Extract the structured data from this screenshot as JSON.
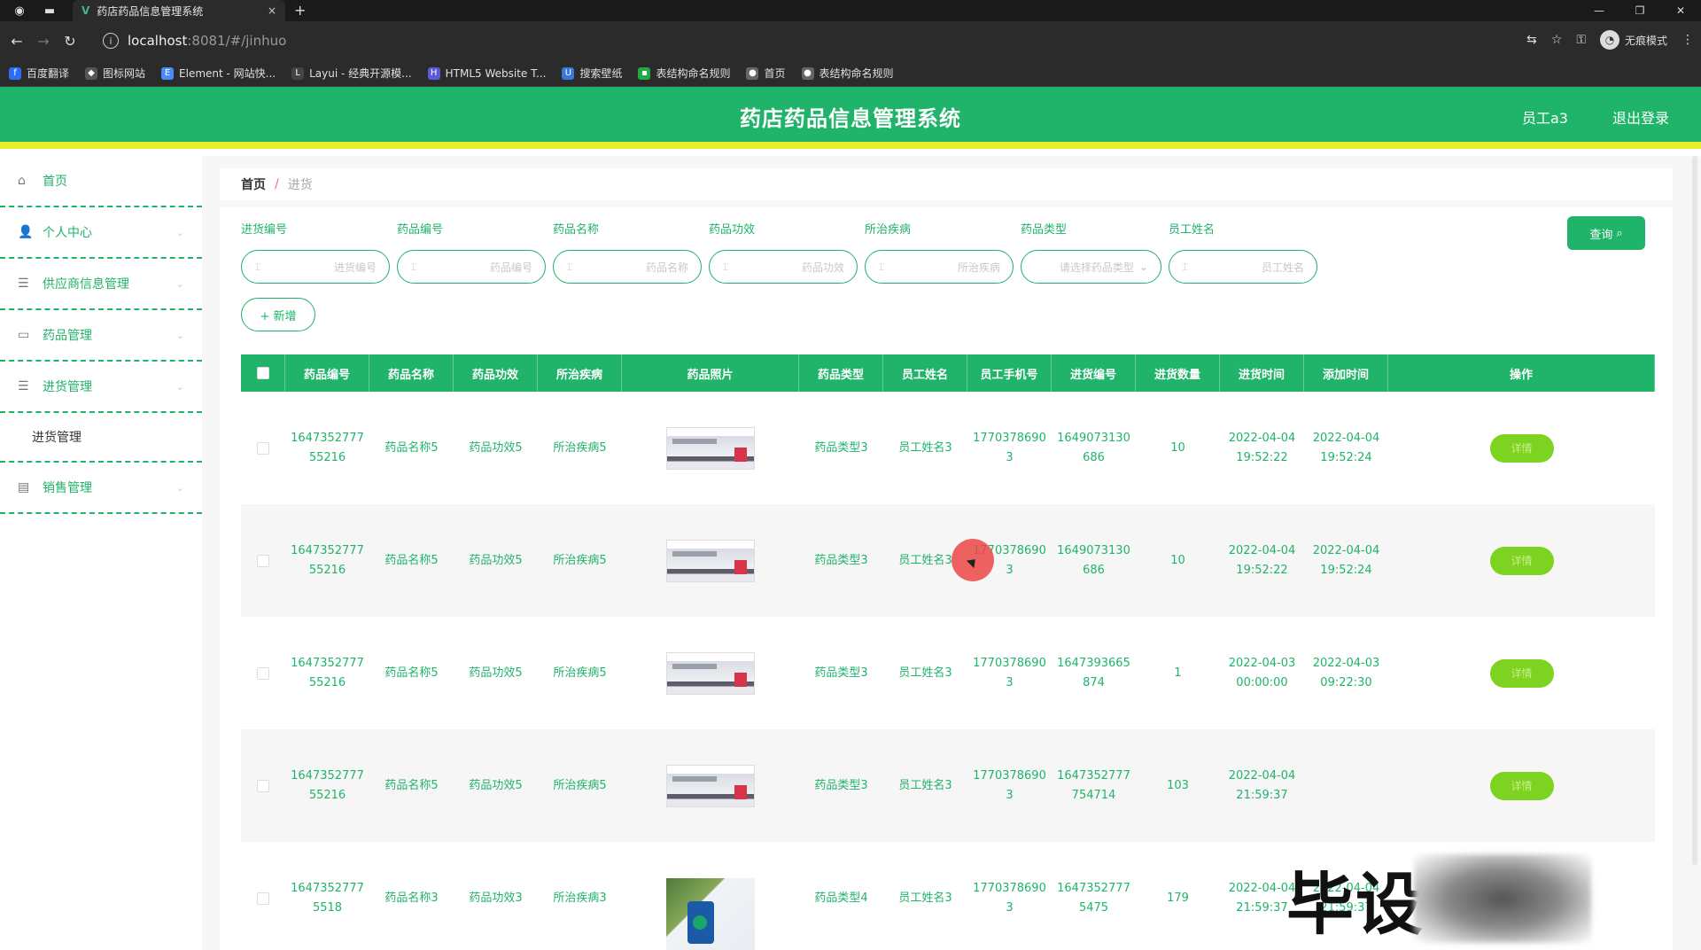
{
  "browser": {
    "tab_title": "药店药品信息管理系统",
    "tab_close": "×",
    "new_tab": "+",
    "url_host": "localhost",
    "url_path": ":8081/#/jinhuo",
    "profile_label": "无痕模式",
    "bookmarks": [
      {
        "label": "百度翻译",
        "color": "#2a6ef5",
        "glyph": "f"
      },
      {
        "label": "图标网站",
        "color": "#555555",
        "glyph": "◆"
      },
      {
        "label": "Element - 网站快...",
        "color": "#4a8cf7",
        "glyph": "E"
      },
      {
        "label": "Layui - 经典开源模...",
        "color": "#444444",
        "glyph": "L"
      },
      {
        "label": "HTML5 Website T...",
        "color": "#5a5ad8",
        "glyph": "H"
      },
      {
        "label": "搜索壁纸",
        "color": "#3a78d8",
        "glyph": "U"
      },
      {
        "label": "表结构命名规则",
        "color": "#22aa44",
        "glyph": "▪"
      },
      {
        "label": "首页",
        "color": "#666666",
        "glyph": "●"
      },
      {
        "label": "表结构命名规则",
        "color": "#666666",
        "glyph": "●"
      }
    ]
  },
  "header": {
    "title": "药店药品信息管理系统",
    "user": "员工a3",
    "logout": "退出登录"
  },
  "sidebar": {
    "items": [
      {
        "label": "首页",
        "icon": "home-icon",
        "glyph": "⌂"
      },
      {
        "label": "个人中心",
        "icon": "user-icon",
        "glyph": "👤"
      },
      {
        "label": "供应商信息管理",
        "icon": "menu-icon",
        "glyph": "☰"
      },
      {
        "label": "药品管理",
        "icon": "document-icon",
        "glyph": "▭"
      },
      {
        "label": "进货管理",
        "icon": "menu-icon",
        "glyph": "☰"
      }
    ],
    "submenu_label": "进货管理",
    "last_item": {
      "label": "销售管理",
      "icon": "chart-icon",
      "glyph": "▤"
    }
  },
  "breadcrumb": {
    "home": "首页",
    "sep": "/",
    "current": "进货"
  },
  "filters": [
    {
      "label": "进货编号",
      "placeholder": "进货编号"
    },
    {
      "label": "药品编号",
      "placeholder": "药品编号"
    },
    {
      "label": "药品名称",
      "placeholder": "药品名称"
    },
    {
      "label": "药品功效",
      "placeholder": "药品功效"
    },
    {
      "label": "所治疾病",
      "placeholder": "所治疾病"
    },
    {
      "label": "药品类型",
      "placeholder": "请选择药品类型"
    },
    {
      "label": "员工姓名",
      "placeholder": "员工姓名"
    }
  ],
  "actions": {
    "search": "查询",
    "add": "+ 新增",
    "detail": "详情"
  },
  "table": {
    "headers": [
      "药品编号",
      "药品名称",
      "药品功效",
      "所治疾病",
      "药品照片",
      "药品类型",
      "员工姓名",
      "员工手机号",
      "进货编号",
      "进货数量",
      "进货时间",
      "添加时间",
      "操作"
    ],
    "rows": [
      {
        "drug_no": "164735277755216",
        "name": "药品名称5",
        "effect": "药品功效5",
        "disease": "所治疾病5",
        "photo": "box",
        "type": "药品类型3",
        "staff": "员工姓名3",
        "phone": "17703786903",
        "purchase_no": "1649073130686",
        "qty": "10",
        "purchase_time": "2022-04-04 19:52:22",
        "add_time": "2022-04-04 19:52:24"
      },
      {
        "drug_no": "164735277755216",
        "name": "药品名称5",
        "effect": "药品功效5",
        "disease": "所治疾病5",
        "photo": "box",
        "type": "药品类型3",
        "staff": "员工姓名3",
        "phone": "17703786903",
        "purchase_no": "1649073130686",
        "qty": "10",
        "purchase_time": "2022-04-04 19:52:22",
        "add_time": "2022-04-04 19:52:24"
      },
      {
        "drug_no": "164735277755216",
        "name": "药品名称5",
        "effect": "药品功效5",
        "disease": "所治疾病5",
        "photo": "box",
        "type": "药品类型3",
        "staff": "员工姓名3",
        "phone": "17703786903",
        "purchase_no": "1647393665874",
        "qty": "1",
        "purchase_time": "2022-04-03 00:00:00",
        "add_time": "2022-04-03 09:22:30"
      },
      {
        "drug_no": "164735277755216",
        "name": "药品名称5",
        "effect": "药品功效5",
        "disease": "所治疾病5",
        "photo": "box",
        "type": "药品类型3",
        "staff": "员工姓名3",
        "phone": "17703786903",
        "purchase_no": "1647352777754714",
        "qty": "103",
        "purchase_time": "2022-04-04 21:59:37",
        "add_time": ""
      },
      {
        "drug_no": "16473527775518",
        "name": "药品名称3",
        "effect": "药品功效3",
        "disease": "所治疾病3",
        "photo": "bottle",
        "type": "药品类型4",
        "staff": "员工姓名3",
        "phone": "17703786903",
        "purchase_no": "16473527775475",
        "qty": "179",
        "purchase_time": "2022-04-04 21:59:37",
        "add_time": "2022-04-04 21:59:37"
      }
    ]
  },
  "watermark": "毕设"
}
